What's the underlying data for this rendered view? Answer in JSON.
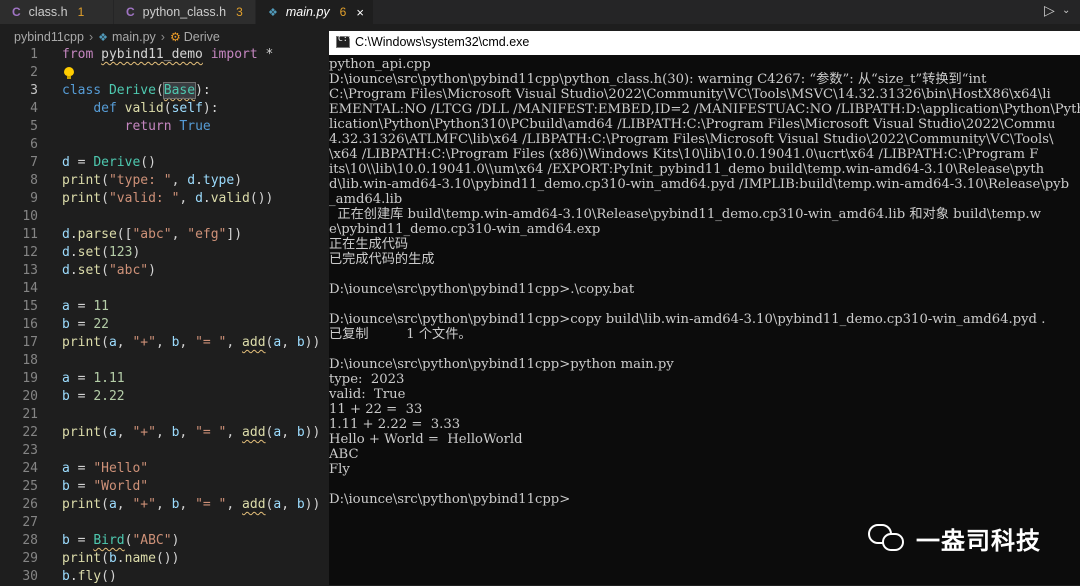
{
  "tabs": [
    {
      "label": "class.h",
      "badge": "1",
      "icon": "C"
    },
    {
      "label": "python_class.h",
      "badge": "3",
      "icon": "C"
    },
    {
      "label": "main.py",
      "badge": "6",
      "icon": "python-icon",
      "close": "×"
    }
  ],
  "breadcrumb": {
    "folder": "pybind11cpp",
    "file": "main.py",
    "symbol": "Derive"
  },
  "editor": {
    "line_numbers": [
      "1",
      "2",
      "3",
      "4",
      "5",
      "6",
      "7",
      "8",
      "9",
      "10",
      "11",
      "12",
      "13",
      "14",
      "15",
      "16",
      "17",
      "18",
      "19",
      "20",
      "21",
      "22",
      "23",
      "24",
      "25",
      "26",
      "27",
      "28",
      "29",
      "30"
    ],
    "code": {
      "l1": [
        "from",
        " ",
        "pybind11_demo",
        " ",
        "import",
        " *"
      ],
      "l3": [
        "class",
        " ",
        "Derive",
        "(",
        "Base",
        "):"
      ],
      "l4": [
        "    ",
        "def",
        " ",
        "valid",
        "(",
        "self",
        "):"
      ],
      "l5": [
        "        ",
        "return",
        " ",
        "True"
      ],
      "l7": [
        "d",
        " = ",
        "Derive",
        "()"
      ],
      "l8": [
        "print",
        "(",
        "\"type: \"",
        ", ",
        "d",
        ".",
        "type",
        ")"
      ],
      "l9": [
        "print",
        "(",
        "\"valid: \"",
        ", ",
        "d",
        ".",
        "valid",
        "())"
      ],
      "l11": [
        "d",
        ".",
        "parse",
        "([",
        "\"abc\"",
        ", ",
        "\"efg\"",
        "])"
      ],
      "l12": [
        "d",
        ".",
        "set",
        "(",
        "123",
        ")"
      ],
      "l13": [
        "d",
        ".",
        "set",
        "(",
        "\"abc\"",
        ")"
      ],
      "l15": [
        "a",
        " = ",
        "11"
      ],
      "l16": [
        "b",
        " = ",
        "22"
      ],
      "l17": [
        "print",
        "(",
        "a",
        ", ",
        "\"+\"",
        ", ",
        "b",
        ", ",
        "\"= \"",
        ", ",
        "add",
        "(",
        "a",
        ", ",
        "b",
        "))"
      ],
      "l19": [
        "a",
        " = ",
        "1.11"
      ],
      "l20": [
        "b",
        " = ",
        "2.22"
      ],
      "l22": [
        "print",
        "(",
        "a",
        ", ",
        "\"+\"",
        ", ",
        "b",
        ", ",
        "\"= \"",
        ", ",
        "add",
        "(",
        "a",
        ", ",
        "b",
        "))"
      ],
      "l24": [
        "a",
        " = ",
        "\"Hello\""
      ],
      "l25": [
        "b",
        " = ",
        "\"World\""
      ],
      "l26": [
        "print",
        "(",
        "a",
        ", ",
        "\"+\"",
        ", ",
        "b",
        ", ",
        "\"= \"",
        ", ",
        "add",
        "(",
        "a",
        ", ",
        "b",
        "))"
      ],
      "l28": [
        "b",
        " = ",
        "Bird",
        "(",
        "\"ABC\"",
        ")"
      ],
      "l29": [
        "print",
        "(",
        "b",
        ".",
        "name",
        "())"
      ],
      "l30": [
        "b",
        ".",
        "fly",
        "()"
      ]
    }
  },
  "cmd": {
    "title": "C:\\Windows\\system32\\cmd.exe",
    "lines": [
      "python_api.cpp",
      "D:\\iounce\\src\\python\\pybind11cpp\\python_class.h(30): warning C4267: “参数”: 从“size_t”转换到“int",
      "C:\\Program Files\\Microsoft Visual Studio\\2022\\Community\\VC\\Tools\\MSVC\\14.32.31326\\bin\\HostX86\\x64\\li",
      "EMENTAL:NO /LTCG /DLL /MANIFEST:EMBED,ID=2 /MANIFESTUAC:NO /LIBPATH:D:\\application\\Python\\Python310\\",
      "lication\\Python\\Python310\\PCbuild\\amd64 /LIBPATH:C:\\Program Files\\Microsoft Visual Studio\\2022\\Commu",
      "4.32.31326\\ATLMFC\\lib\\x64 /LIBPATH:C:\\Program Files\\Microsoft Visual Studio\\2022\\Community\\VC\\Tools\\",
      "\\x64 /LIBPATH:C:\\Program Files (x86)\\Windows Kits\\10\\lib\\10.0.19041.0\\ucrt\\x64 /LIBPATH:C:\\Program F",
      "its\\10\\\\lib\\10.0.19041.0\\\\um\\x64 /EXPORT:PyInit_pybind11_demo build\\temp.win-amd64-3.10\\Release\\pyth",
      "d\\lib.win-amd64-3.10\\pybind11_demo.cp310-win_amd64.pyd /IMPLIB:build\\temp.win-amd64-3.10\\Release\\pyb",
      "_amd64.lib",
      "  正在创建库 build\\temp.win-amd64-3.10\\Release\\pybind11_demo.cp310-win_amd64.lib 和对象 build\\temp.w",
      "e\\pybind11_demo.cp310-win_amd64.exp",
      "正在生成代码",
      "已完成代码的生成",
      "",
      "D:\\iounce\\src\\python\\pybind11cpp>.\\copy.bat",
      "",
      "D:\\iounce\\src\\python\\pybind11cpp>copy build\\lib.win-amd64-3.10\\pybind11_demo.cp310-win_amd64.pyd .",
      "已复制         1 个文件。",
      "",
      "D:\\iounce\\src\\python\\pybind11cpp>python main.py",
      "type:  2023",
      "valid:  True",
      "11 + 22 =  33",
      "1.11 + 2.22 =  3.33",
      "Hello + World =  HelloWorld",
      "ABC",
      "Fly",
      "",
      "D:\\iounce\\src\\python\\pybind11cpp>"
    ]
  },
  "watermark": {
    "text": "一盎司科技"
  },
  "colors": {
    "keyword": "#c586c0",
    "builtin_kw": "#569cd6",
    "function": "#dcdcaa",
    "class": "#4ec9b0",
    "string": "#ce9178",
    "number": "#b5cea8",
    "variable": "#9cdcfe",
    "badge": "#e2a02c"
  }
}
